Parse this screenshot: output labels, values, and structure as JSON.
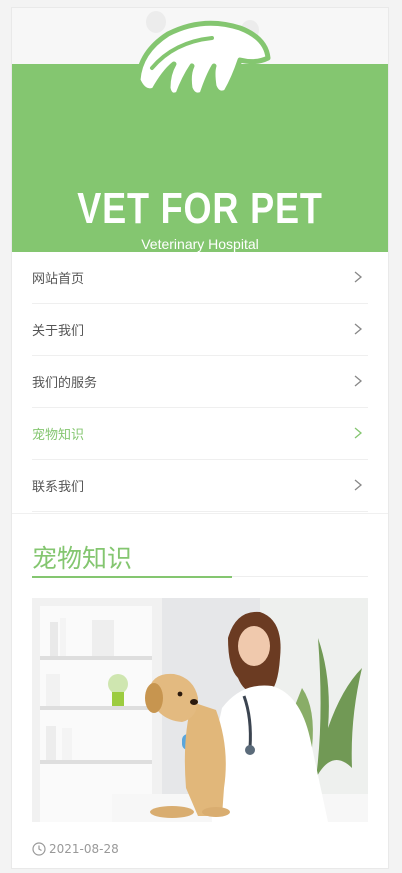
{
  "brand": {
    "title": "VET FOR PET",
    "subtitle": "Veterinary Hospital"
  },
  "nav": {
    "items": [
      {
        "label": "网站首页",
        "active": false
      },
      {
        "label": "关于我们",
        "active": false
      },
      {
        "label": "我们的服务",
        "active": false
      },
      {
        "label": "宠物知识",
        "active": true
      },
      {
        "label": "联系我们",
        "active": false
      }
    ]
  },
  "section": {
    "title": "宠物知识"
  },
  "article": {
    "date": "2021-08-28"
  },
  "colors": {
    "accent": "#84c670",
    "text": "#555555",
    "meta": "#999999"
  },
  "icons": {
    "chevron": "chevron-right-icon",
    "clock": "clock-icon",
    "logo": "paw-logo-icon"
  }
}
